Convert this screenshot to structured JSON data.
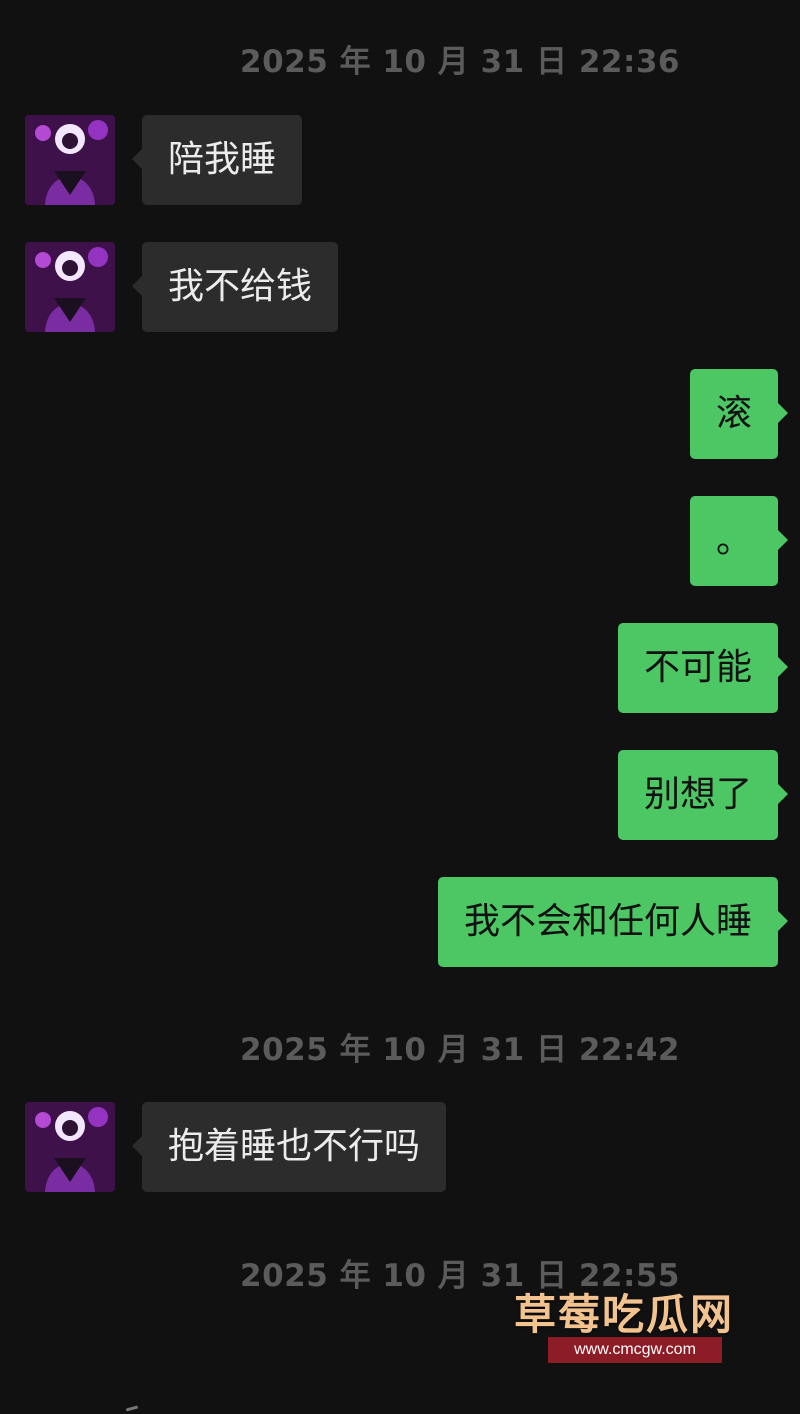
{
  "timestamps": [
    "2025 年 10 月 31 日 22:36",
    "2025 年 10 月 31 日 22:42",
    "2025 年 10 月 31 日 22:55"
  ],
  "messages": [
    {
      "side": "in",
      "text": "陪我睡"
    },
    {
      "side": "in",
      "text": "我不给钱"
    },
    {
      "side": "out",
      "text": "滚"
    },
    {
      "side": "out",
      "text": "。"
    },
    {
      "side": "out",
      "text": "不可能"
    },
    {
      "side": "out",
      "text": "别想了"
    },
    {
      "side": "out",
      "text": "我不会和任何人睡"
    },
    {
      "side": "in",
      "text": "抱着睡也不行吗"
    }
  ],
  "watermark": {
    "title": "草莓吃瓜网",
    "url": "www.cmcgw.com"
  },
  "colors": {
    "background": "#111111",
    "incoming_bubble": "#2c2c2c",
    "outgoing_bubble": "#4cc764",
    "timestamp": "#5b5b5b",
    "watermark_title": "#f2c38f",
    "watermark_url_bg": "#8c1c25"
  },
  "icons": {
    "avatar": "contact-avatar-icon"
  }
}
